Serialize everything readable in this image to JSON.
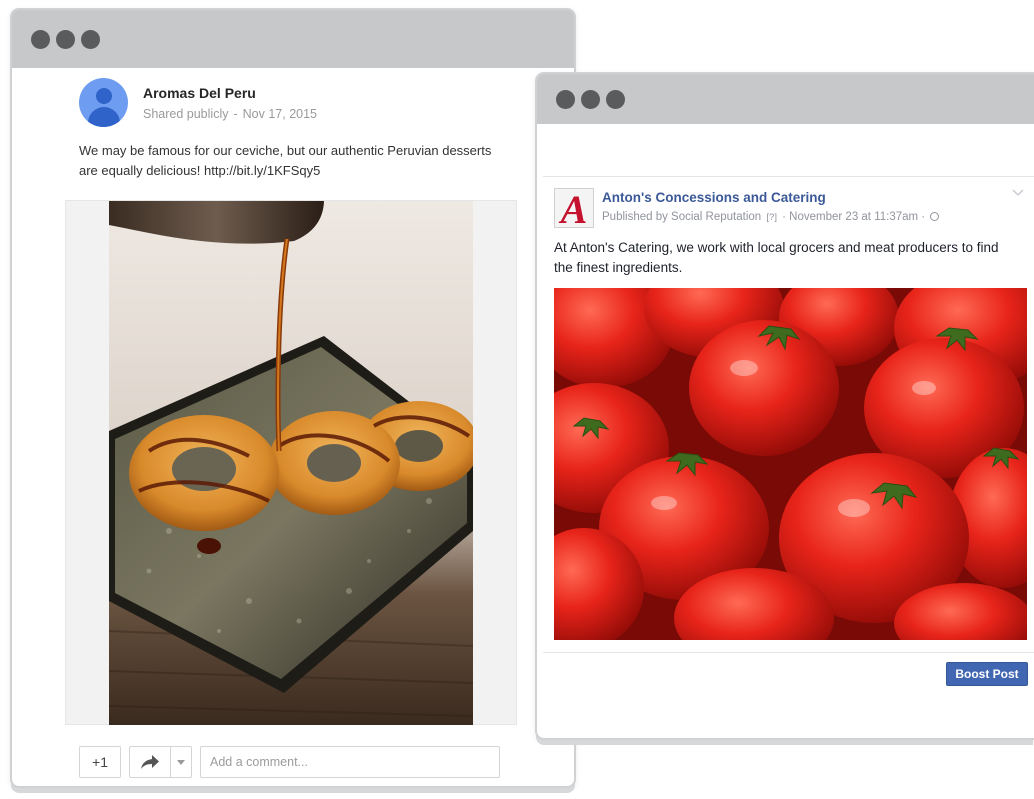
{
  "google_plus_post": {
    "author": "Aromas Del Peru",
    "visibility": "Shared publicly",
    "separator": "-",
    "date": "Nov 17, 2015",
    "text": "We may be famous for our ceviche, but our authentic Peruvian desserts are equally delicious! http://bit.ly/1KFSqy5",
    "actions": {
      "plus_one_label": "+1",
      "comment_placeholder": "Add a comment..."
    }
  },
  "facebook_post": {
    "page_name": "Anton's Concessions and Catering",
    "published_by": "Published by Social Reputation",
    "help_marker": "[?]",
    "timestamp": "· November 23 at 11:37am ·",
    "text": "At Anton's Catering, we work with local grocers and meat producers to find the finest ingredients.",
    "boost_label": "Boost Post",
    "logo_letter": "A"
  },
  "colors": {
    "window_bar": "#c7c8c9",
    "window_dot": "#5a5b5d",
    "gplus_avatar": "#6d9cf0",
    "fb_link": "#3b5998",
    "fb_button": "#4267b2",
    "logo_red": "#c4122f"
  }
}
